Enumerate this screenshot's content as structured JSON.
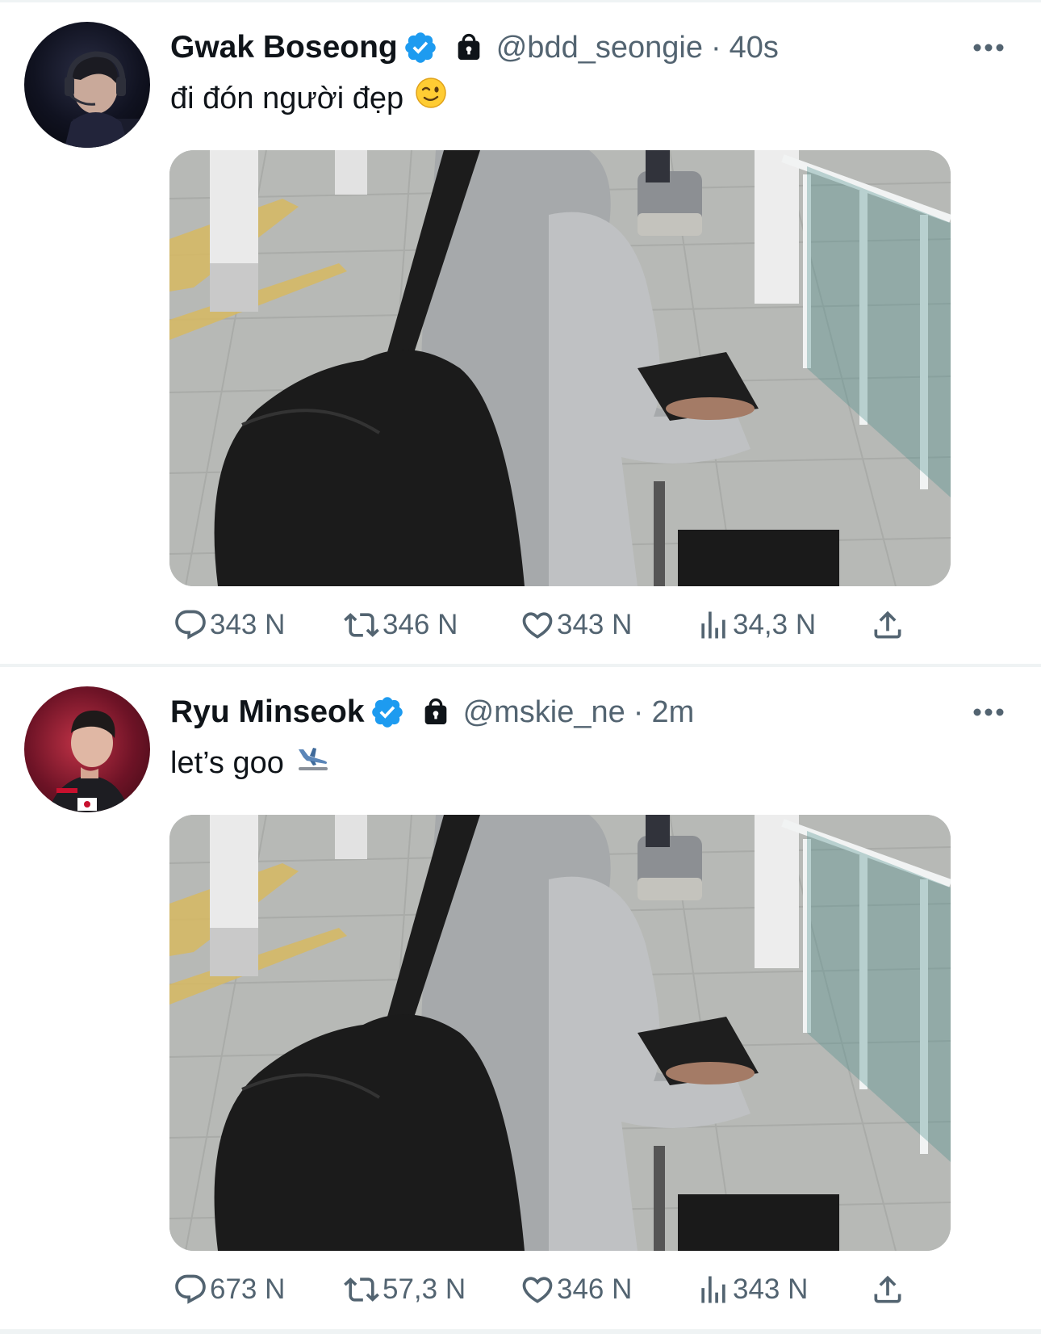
{
  "tweets": [
    {
      "name": "Gwak Boseong",
      "handle": "@bdd_seongie",
      "separator": "·",
      "time": "40s",
      "text": "đi đón người đẹp",
      "emoji": "😉",
      "stats": {
        "replies": "343 N",
        "reposts": "346 N",
        "likes": "343 N",
        "views": "34,3 N"
      }
    },
    {
      "name": "Ryu Minseok",
      "handle": "@mskie_ne",
      "separator": "·",
      "time": "2m",
      "text": "let’s goo",
      "emoji": "🛬",
      "stats": {
        "replies": "673 N",
        "reposts": "57,3 N",
        "likes": "346 N",
        "views": "343 N"
      }
    }
  ],
  "icons": {
    "verified": "verified-badge-icon",
    "protected": "lock-icon",
    "more": "more-icon",
    "reply": "reply-icon",
    "repost": "repost-icon",
    "like": "like-icon",
    "views": "views-icon",
    "share": "share-icon"
  },
  "colors": {
    "verified": "#1d9bf0",
    "secondary_text": "#536471",
    "primary_text": "#0f1419",
    "divider": "#eff3f4"
  }
}
